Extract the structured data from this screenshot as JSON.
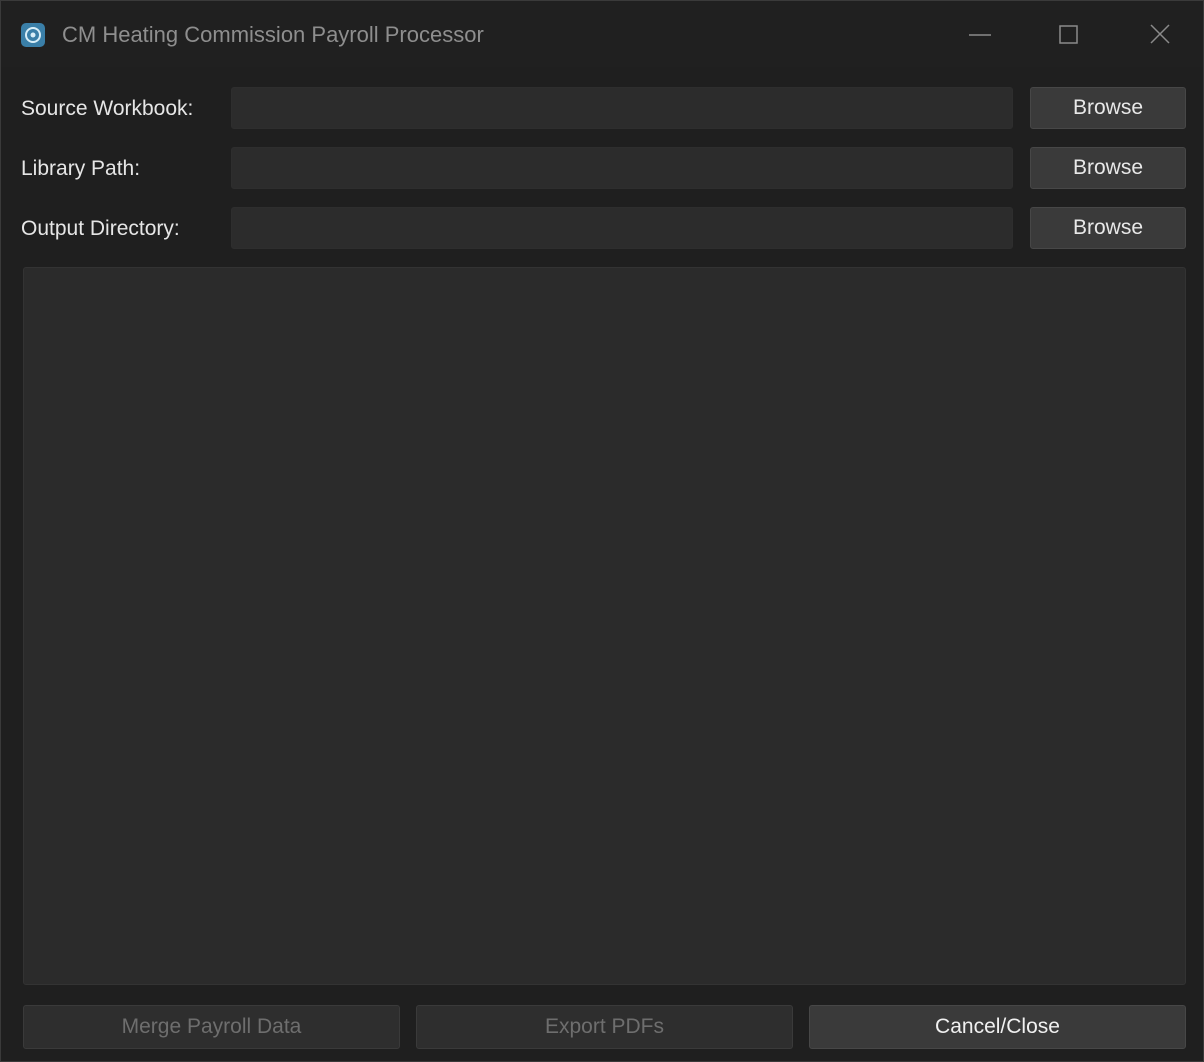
{
  "window": {
    "title": "CM Heating Commission Payroll Processor",
    "icon": "app-icon"
  },
  "form": {
    "source_workbook": {
      "label": "Source Workbook:",
      "value": "",
      "browse_label": "Browse"
    },
    "library_path": {
      "label": "Library Path:",
      "value": "",
      "browse_label": "Browse"
    },
    "output_directory": {
      "label": "Output Directory:",
      "value": "",
      "browse_label": "Browse"
    }
  },
  "log": {
    "text": ""
  },
  "actions": {
    "merge_label": "Merge Payroll Data",
    "merge_enabled": false,
    "export_label": "Export PDFs",
    "export_enabled": false,
    "cancel_label": "Cancel/Close",
    "cancel_enabled": true
  },
  "colors": {
    "background": "#1f1f1f",
    "input_bg": "#2c2c2c",
    "button_bg": "#3a3a3a",
    "log_bg": "#2b2b2b",
    "app_icon": "#3a7fa8"
  }
}
